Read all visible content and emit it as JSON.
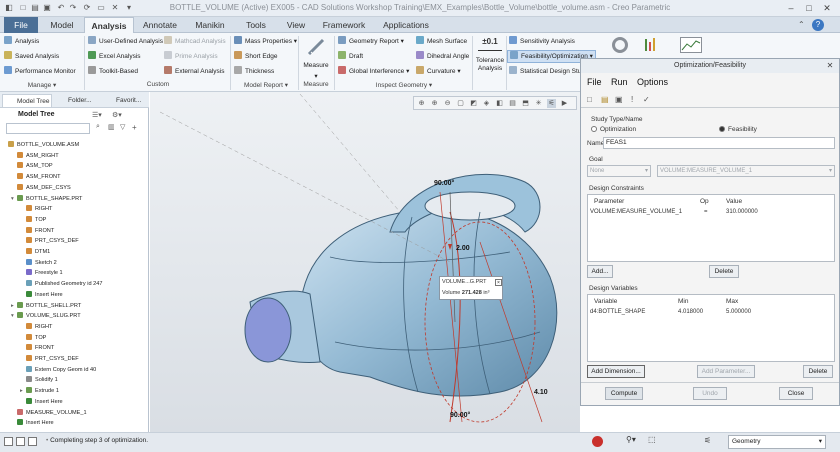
{
  "window_title": "BOTTLE_VOLUME (Active) EX005 - CAD Solutions Workshop Training\\EMX_Examples\\Bottle_Volume\\bottle_volume.asm - Creo Parametric",
  "menu": {
    "file": "File",
    "tabs": [
      "Model",
      "Analysis",
      "Annotate",
      "Manikin",
      "Tools",
      "View",
      "Framework",
      "Applications"
    ]
  },
  "ribbon": {
    "manage": {
      "items": [
        "Analysis",
        "Saved Analysis",
        "Performance Monitor"
      ],
      "label": "Manage"
    },
    "custom": {
      "items": [
        "User-Defined Analysis",
        "Excel Analysis",
        "Toolkit-Based",
        "Mathcad Analysis",
        "Prime Analysis",
        "External Analysis"
      ],
      "label": "Custom"
    },
    "model_report": {
      "items": [
        "Mass Properties",
        "Short Edge",
        "Thickness"
      ],
      "label": "Model Report"
    },
    "measure": {
      "item": "Measure",
      "label": "Measure"
    },
    "inspect": {
      "items": [
        "Geometry Report",
        "Draft",
        "Global Interference",
        "Mesh Surface",
        "Dihedral Angle",
        "Curvature"
      ],
      "label": "Inspect Geometry"
    },
    "tolerance": {
      "item": "Tolerance Analysis",
      "symbol": "±0.1"
    },
    "design": {
      "items": [
        "Sensitivity Analysis",
        "Feasibility/Optimization",
        "Statistical Design Study"
      ]
    }
  },
  "tree": {
    "tabs": [
      "Model Tree",
      "Folder...",
      "Favorit..."
    ],
    "title": "Model Tree",
    "items": [
      {
        "text": "BOTTLE_VOLUME.ASM",
        "indent": 0,
        "icon": "asm"
      },
      {
        "text": "ASM_RIGHT",
        "indent": 1,
        "icon": "plane"
      },
      {
        "text": "ASM_TOP",
        "indent": 1,
        "icon": "plane"
      },
      {
        "text": "ASM_FRONT",
        "indent": 1,
        "icon": "plane"
      },
      {
        "text": "ASM_DEF_CSYS",
        "indent": 1,
        "icon": "csys"
      },
      {
        "text": "BOTTLE_SHAPE.PRT",
        "indent": 1,
        "icon": "part",
        "exp": "▾"
      },
      {
        "text": "RIGHT",
        "indent": 2,
        "icon": "plane"
      },
      {
        "text": "TOP",
        "indent": 2,
        "icon": "plane"
      },
      {
        "text": "FRONT",
        "indent": 2,
        "icon": "plane"
      },
      {
        "text": "PRT_CSYS_DEF",
        "indent": 2,
        "icon": "csys"
      },
      {
        "text": "DTM1",
        "indent": 2,
        "icon": "plane"
      },
      {
        "text": "Sketch 2",
        "indent": 2,
        "icon": "sketch"
      },
      {
        "text": "Freestyle 1",
        "indent": 2,
        "icon": "free"
      },
      {
        "text": "Published Geometry id 247",
        "indent": 2,
        "icon": "pub"
      },
      {
        "text": "Insert Here",
        "indent": 2,
        "icon": "insert"
      },
      {
        "text": "BOTTLE_SHELL.PRT",
        "indent": 1,
        "icon": "part",
        "exp": "▸"
      },
      {
        "text": "VOLUME_SLUG.PRT",
        "indent": 1,
        "icon": "part",
        "exp": "▾"
      },
      {
        "text": "RIGHT",
        "indent": 2,
        "icon": "plane"
      },
      {
        "text": "TOP",
        "indent": 2,
        "icon": "plane"
      },
      {
        "text": "FRONT",
        "indent": 2,
        "icon": "plane"
      },
      {
        "text": "PRT_CSYS_DEF",
        "indent": 2,
        "icon": "csys"
      },
      {
        "text": "Extern Copy Geom id 40",
        "indent": 2,
        "icon": "pub"
      },
      {
        "text": "Solidify 1",
        "indent": 2,
        "icon": "solid"
      },
      {
        "text": "Extrude 1",
        "indent": 2,
        "icon": "extrude",
        "exp": "▸"
      },
      {
        "text": "Insert Here",
        "indent": 2,
        "icon": "insert"
      },
      {
        "text": "MEASURE_VOLUME_1",
        "indent": 1,
        "icon": "measure"
      },
      {
        "text": "Insert Here",
        "indent": 1,
        "icon": "insert"
      }
    ]
  },
  "viewport": {
    "dims": {
      "angle_top": "90.00°",
      "dim_mid": "2.00",
      "dim_right": "4.10",
      "angle_bottom": "90.00°"
    },
    "callout": {
      "name": "VOLUME...G.PRT",
      "label": "Volume",
      "value": "271.428",
      "unit": "in³"
    }
  },
  "dialog": {
    "title": "Optimization/Feasibility",
    "menu": [
      "File",
      "Run",
      "Options"
    ],
    "study_type": {
      "label": "Study Type/Name",
      "options": [
        "Optimization",
        "Feasibility"
      ],
      "selected": "Feasibility"
    },
    "name": {
      "label": "Name",
      "value": "FEAS1"
    },
    "goal": {
      "label": "Goal",
      "type": "None",
      "measure": "VOLUME:MEASURE_VOLUME_1"
    },
    "constraints": {
      "label": "Design Constraints",
      "headers": [
        "Parameter",
        "Op",
        "Value"
      ],
      "rows": [
        [
          "VOLUME:MEASURE_VOLUME_1",
          "=",
          "310.000000"
        ]
      ],
      "add": "Add...",
      "delete": "Delete"
    },
    "variables": {
      "label": "Design Variables",
      "headers": [
        "Variable",
        "Min",
        "Max"
      ],
      "rows": [
        [
          "d4:BOTTLE_SHAPE",
          "4.018000",
          "5.000000"
        ]
      ],
      "add_dim": "Add Dimension...",
      "add_param": "Add Parameter...",
      "delete": "Delete"
    },
    "buttons": {
      "compute": "Compute",
      "undo": "Undo",
      "close": "Close"
    }
  },
  "status": {
    "message": "Completing step 3 of optimization.",
    "filter": "Geometry"
  }
}
